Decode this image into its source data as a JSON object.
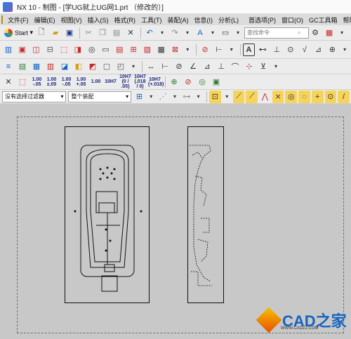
{
  "window": {
    "title": "NX 10 - 制图 - [学UG就上UG网1.prt （修改的）]"
  },
  "menu": {
    "items": [
      "文件(F)",
      "编辑(E)",
      "视图(V)",
      "插入(S)",
      "格式(R)",
      "工具(T)",
      "装配(A)",
      "信息(I)",
      "分析(L)"
    ],
    "right_items": [
      "首选项(P)",
      "窗口(O)",
      "GC工具箱",
      "帮助(H)"
    ]
  },
  "toolbar1": {
    "start_label": "Start",
    "search_placeholder": "查找命令"
  },
  "toolbar4": {
    "tolerances": [
      {
        "top": "1.00",
        "bottom": "-.05"
      },
      {
        "top": "1.00",
        "bottom": "±.05"
      },
      {
        "top": "1.00",
        "bottom": "-.05"
      },
      {
        "top": "1.00",
        "bottom": "+.05"
      },
      {
        "top": "1.00",
        "bottom": ""
      },
      {
        "top": "10H7",
        "bottom": ""
      },
      {
        "top": "10H7",
        "bottom": "(0 / .05)"
      },
      {
        "top": "10H7",
        "bottom": "(.018 / 0)"
      },
      {
        "top": "10H7",
        "bottom": "(+.018)"
      }
    ]
  },
  "filters": {
    "selection_filter": "没有选择过滤器",
    "assembly_scope": "整个装配"
  },
  "watermark": {
    "brand": "CAD之家",
    "url": "WWW.CADZJ.COM"
  }
}
